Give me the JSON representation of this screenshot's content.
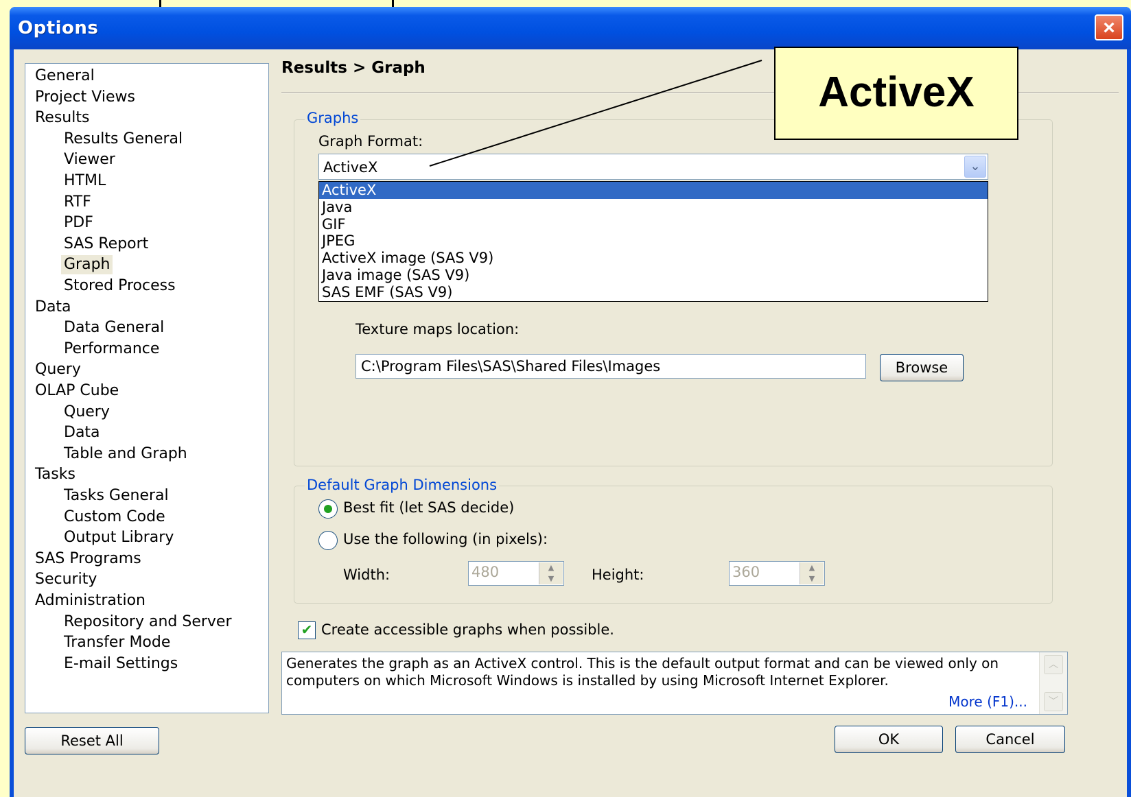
{
  "window": {
    "title": "Options",
    "close_icon": "×"
  },
  "tree": {
    "items": [
      {
        "label": "General",
        "level": 0
      },
      {
        "label": "Project Views",
        "level": 0
      },
      {
        "label": "Results",
        "level": 0
      },
      {
        "label": "Results General",
        "level": 1
      },
      {
        "label": "Viewer",
        "level": 1
      },
      {
        "label": "HTML",
        "level": 1
      },
      {
        "label": "RTF",
        "level": 1
      },
      {
        "label": "PDF",
        "level": 1
      },
      {
        "label": "SAS Report",
        "level": 1
      },
      {
        "label": "Graph",
        "level": 1,
        "selected": true
      },
      {
        "label": "Stored Process",
        "level": 1
      },
      {
        "label": "Data",
        "level": 0
      },
      {
        "label": "Data General",
        "level": 1
      },
      {
        "label": "Performance",
        "level": 1
      },
      {
        "label": "Query",
        "level": 0
      },
      {
        "label": "OLAP Cube",
        "level": 0
      },
      {
        "label": "Query",
        "level": 1
      },
      {
        "label": "Data",
        "level": 1
      },
      {
        "label": "Table and Graph",
        "level": 1
      },
      {
        "label": "Tasks",
        "level": 0
      },
      {
        "label": "Tasks General",
        "level": 1
      },
      {
        "label": "Custom Code",
        "level": 1
      },
      {
        "label": "Output Library",
        "level": 1
      },
      {
        "label": "SAS Programs",
        "level": 0
      },
      {
        "label": "Security",
        "level": 0
      },
      {
        "label": "Administration",
        "level": 0
      },
      {
        "label": "Repository and Server",
        "level": 1
      },
      {
        "label": "Transfer Mode",
        "level": 1
      },
      {
        "label": "E-mail Settings",
        "level": 1
      }
    ]
  },
  "panel": {
    "header": "Results > Graph",
    "graphs_group": "Graphs",
    "graph_format_label": "Graph Format:",
    "graph_format_value": "ActiveX",
    "dropdown_options": [
      "ActiveX",
      "Java",
      "GIF",
      "JPEG",
      "ActiveX image (SAS V9)",
      "Java image (SAS V9)",
      "SAS EMF (SAS V9)"
    ],
    "texture_label": "Texture maps location:",
    "texture_value": "C:\\Program Files\\SAS\\Shared Files\\Images",
    "browse_label": "Browse",
    "dimensions_group": "Default Graph Dimensions",
    "best_fit_label": "Best fit (let SAS decide)",
    "use_following_label": "Use the following (in pixels):",
    "width_label": "Width:",
    "width_value": "480",
    "height_label": "Height:",
    "height_value": "360",
    "accessible_label": "Create accessible graphs when possible.",
    "description": "Generates the graph as an ActiveX control. This is the default output format and can be viewed only on computers on which Microsoft Windows is installed by using Microsoft Internet Explorer.",
    "more_link": "More (F1)..."
  },
  "buttons": {
    "reset_all": "Reset All",
    "ok": "OK",
    "cancel": "Cancel"
  },
  "callout": {
    "text": "ActiveX"
  },
  "colors": {
    "titlebar": "#0a5ae8",
    "accent": "#0046d5",
    "highlight": "#316ac5",
    "callout_bg": "#ffffc0"
  }
}
